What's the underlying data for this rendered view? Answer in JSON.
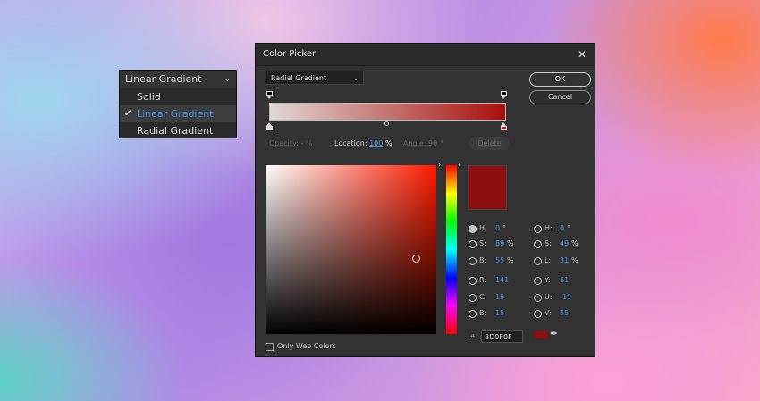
{
  "menu": {
    "current": "Linear Gradient",
    "items": [
      "Solid",
      "Linear Gradient",
      "Radial Gradient"
    ],
    "selected": "Linear Gradient"
  },
  "dialog": {
    "title": "Color Picker",
    "gradient_type": "Radial Gradient",
    "ok": "OK",
    "cancel": "Cancel",
    "opacity_label": "Opacity:",
    "opacity_value": "- %",
    "location_label": "Location:",
    "location_value": "100",
    "location_unit": "%",
    "angle_label": "Angle:",
    "angle_value": "90 °",
    "delete": "Delete",
    "hsb": [
      {
        "label": "H:",
        "value": "0",
        "unit": "°"
      },
      {
        "label": "S:",
        "value": "89",
        "unit": "%"
      },
      {
        "label": "B:",
        "value": "55",
        "unit": "%"
      }
    ],
    "rgb": [
      {
        "label": "R:",
        "value": "141"
      },
      {
        "label": "G:",
        "value": "15"
      },
      {
        "label": "B:",
        "value": "15"
      }
    ],
    "hsl": [
      {
        "label": "H:",
        "value": "0",
        "unit": "°"
      },
      {
        "label": "S:",
        "value": "49",
        "unit": "%"
      },
      {
        "label": "L:",
        "value": "31",
        "unit": "%"
      }
    ],
    "yuv": [
      {
        "label": "Y:",
        "value": "61"
      },
      {
        "label": "U:",
        "value": "-19"
      },
      {
        "label": "V:",
        "value": "55"
      }
    ],
    "hex_label": "#",
    "hex": "8D0F0F",
    "only_web": "Only Web Colors",
    "colors": {
      "current": "#8d0f0f",
      "stop_start": "#e1d8d6",
      "stop_end": "#a8100d"
    }
  }
}
